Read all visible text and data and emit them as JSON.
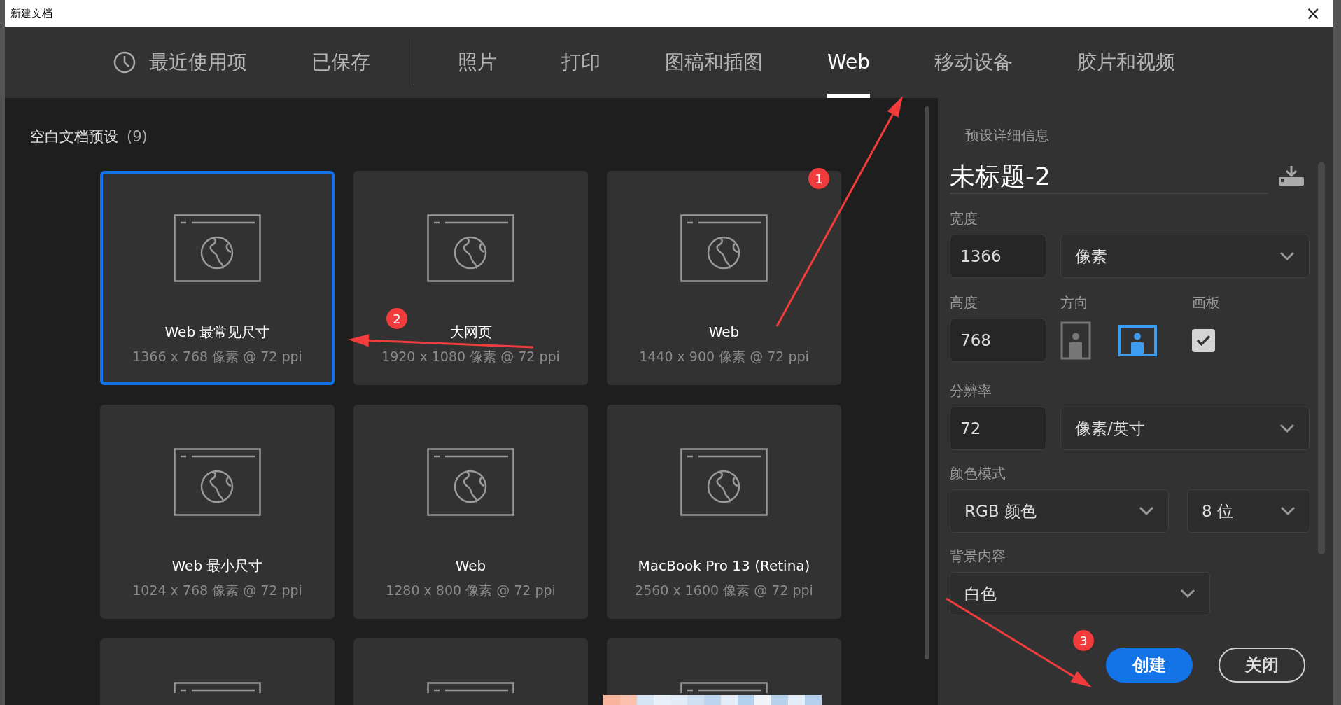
{
  "window": {
    "title": "新建文档",
    "close": "×"
  },
  "tabs": [
    {
      "label": "最近使用项",
      "kind": "recent",
      "selected": false,
      "separator_after": false
    },
    {
      "label": "已保存",
      "kind": "plain",
      "selected": false,
      "separator_after": true
    },
    {
      "label": "照片",
      "kind": "plain",
      "selected": false,
      "separator_after": false
    },
    {
      "label": "打印",
      "kind": "plain",
      "selected": false,
      "separator_after": false
    },
    {
      "label": "图稿和插图",
      "kind": "plain",
      "selected": false,
      "separator_after": false
    },
    {
      "label": "Web",
      "kind": "plain",
      "selected": true,
      "separator_after": false
    },
    {
      "label": "移动设备",
      "kind": "plain",
      "selected": false,
      "separator_after": false
    },
    {
      "label": "胶片和视频",
      "kind": "plain",
      "selected": false,
      "separator_after": false
    }
  ],
  "presets": {
    "title": "空白文档预设",
    "count": "(9)",
    "items": [
      {
        "kind": "card",
        "name": "Web 最常见尺寸",
        "size": "1366 x 768 像素 @ 72 ppi",
        "selected": true
      },
      {
        "kind": "card",
        "name": "大网页",
        "size": "1920 x 1080 像素 @ 72 ppi",
        "selected": false
      },
      {
        "kind": "card",
        "name": "Web",
        "size": "1440 x 900 像素 @ 72 ppi",
        "selected": false
      },
      {
        "kind": "card",
        "name": "Web 最小尺寸",
        "size": "1024 x 768 像素 @ 72 ppi",
        "selected": false
      },
      {
        "kind": "card",
        "name": "Web",
        "size": "1280 x 800 像素 @ 72 ppi",
        "selected": false
      },
      {
        "kind": "card",
        "name": "MacBook Pro 13 (Retina)",
        "size": "2560 x 1600 像素 @ 72 ppi",
        "selected": false
      },
      {
        "kind": "cut",
        "selected": false
      },
      {
        "kind": "cut",
        "selected": false
      },
      {
        "kind": "cut",
        "selected": false
      }
    ]
  },
  "details": {
    "heading": "预设详细信息",
    "doc_name": "未标题-2",
    "width": {
      "label": "宽度",
      "value": "1366",
      "unit": "像素"
    },
    "height": {
      "label": "高度",
      "value": "768"
    },
    "orientation": {
      "label": "方向",
      "options": [
        {
          "kind": "portrait",
          "selected": false
        },
        {
          "kind": "landscape",
          "selected": true
        }
      ]
    },
    "artboard": {
      "label": "画板",
      "checked": true
    },
    "resolution": {
      "label": "分辨率",
      "value": "72",
      "unit": "像素/英寸"
    },
    "color_mode": {
      "label": "颜色模式",
      "mode": "RGB 颜色",
      "depth": "8 位"
    },
    "background": {
      "label": "背景内容",
      "value": "白色"
    },
    "buttons": [
      {
        "label": "创建",
        "kind": "primary"
      },
      {
        "label": "关闭",
        "kind": "secondary"
      }
    ]
  },
  "annotations": [
    {
      "number": "1"
    },
    {
      "number": "2"
    },
    {
      "number": "3"
    }
  ]
}
